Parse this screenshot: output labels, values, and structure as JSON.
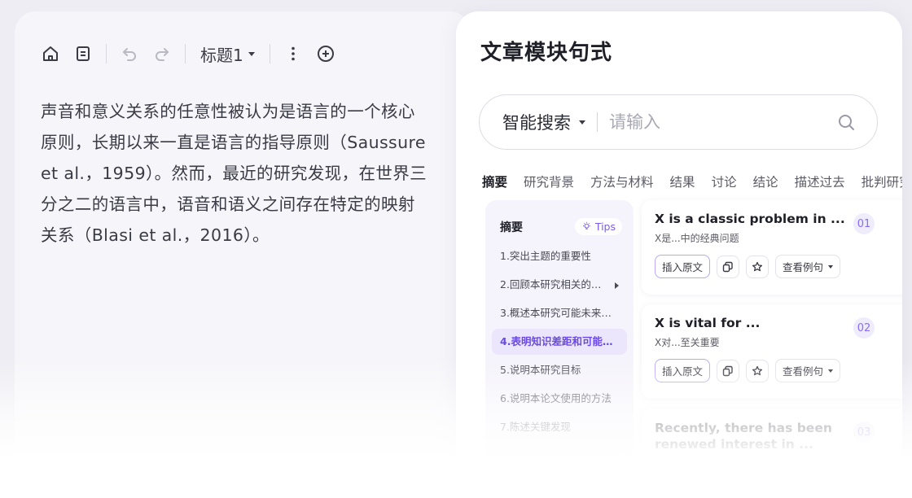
{
  "editor": {
    "toolbar": {
      "icons": [
        "home-icon",
        "document-icon",
        "undo-icon",
        "redo-icon",
        "more-vertical-icon",
        "add-circle-icon"
      ],
      "heading_label": "标题1"
    },
    "paragraph": "声音和意义关系的任意性被认为是语言的一个核心原则，长期以来一直是语言的指导原则（Saussure et al.，1959）。然而，最近的研究发现，在世界三分之二的语言中，语音和语义之间存在特定的映射关系（Blasi et al.，2016）。"
  },
  "panel": {
    "title": "文章模块句式",
    "search": {
      "mode_label": "智能搜索",
      "placeholder": "请输入"
    },
    "tabs": [
      {
        "label": "摘要",
        "active": true
      },
      {
        "label": "研究背景"
      },
      {
        "label": "方法与材料"
      },
      {
        "label": "结果"
      },
      {
        "label": "讨论"
      },
      {
        "label": "结论"
      },
      {
        "label": "描述过去"
      },
      {
        "label": "批判研究"
      }
    ],
    "outline": {
      "title": "摘要",
      "tips_label": "Tips",
      "items": [
        "1.突出主题的重要性",
        "2.回顾本研究相关的…",
        "3.概述本研究可能未来…",
        "4.表明知识差距和可能…",
        "5.说明本研究目标",
        "6.说明本论文使用的方法",
        "7.陈述关键发现"
      ],
      "selected_index": 3
    },
    "cards": [
      {
        "en": "X is a classic problem in ...",
        "zh": "X是...中的经典问题",
        "num": "01"
      },
      {
        "en": "X is vital for ...",
        "zh": "X对...至关重要",
        "num": "02"
      },
      {
        "en": "Recently, there has been renewed interest in ...",
        "zh": "",
        "num": "03"
      }
    ],
    "card_actions": {
      "insert_label": "插入原文",
      "examples_label": "查看例句"
    }
  },
  "colors": {
    "accent": "#7b5cf0",
    "background": "#eeedf3",
    "panel": "#ffffff"
  }
}
